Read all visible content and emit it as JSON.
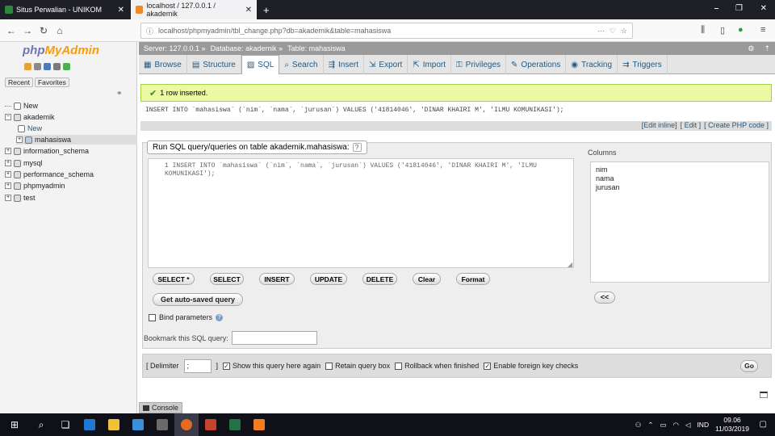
{
  "browser": {
    "tabs": [
      {
        "title": "Situs Perwalian - UNIKOM",
        "color": "#2c8a3e"
      },
      {
        "title": "localhost / 127.0.0.1 / akademik",
        "color": "#f08a24"
      }
    ],
    "url": "localhost/phpmyadmin/tbl_change.php?db=akademik&table=mahasiswa"
  },
  "sidebar": {
    "logo_main": "php",
    "logo_accent": "MyAdmin",
    "subtabs": [
      "Recent",
      "Favorites"
    ],
    "tree": [
      {
        "label": "New",
        "level": 0,
        "toggle": ""
      },
      {
        "label": "akademik",
        "level": 0,
        "toggle": "−"
      },
      {
        "label": "New",
        "level": 1,
        "toggle": ""
      },
      {
        "label": "mahasiswa",
        "level": 1,
        "toggle": "+"
      },
      {
        "label": "information_schema",
        "level": 0,
        "toggle": "+"
      },
      {
        "label": "mysql",
        "level": 0,
        "toggle": "+"
      },
      {
        "label": "performance_schema",
        "level": 0,
        "toggle": "+"
      },
      {
        "label": "phpmyadmin",
        "level": 0,
        "toggle": "+"
      },
      {
        "label": "test",
        "level": 0,
        "toggle": "+"
      }
    ]
  },
  "breadcrumb": {
    "server": "Server: 127.0.0.1 »",
    "database": "Database: akademik »",
    "table": "Table: mahasiswa"
  },
  "tabs": [
    "Browse",
    "Structure",
    "SQL",
    "Search",
    "Insert",
    "Export",
    "Import",
    "Privileges",
    "Operations",
    "Tracking",
    "Triggers"
  ],
  "active_tab": "SQL",
  "success_message": "1 row inserted.",
  "executed_sql": "INSERT INTO `mahasiswa` (`nim`, `nama`, `jurusan`) VALUES ('41814046', 'DINAR KHAIRI M', 'ILMU KOMUNIKASI');",
  "sql_links": [
    "[Edit inline]",
    "[ Edit ]",
    "[ Create PHP code ]"
  ],
  "query_legend": "Run SQL query/queries on table akademik.mahasiswa:",
  "editor_text": "1 INSERT INTO `mahasiswa` (`nim`, `nama`, `jurusan`) VALUES ('41814046', 'DINAR KHAIRI M', 'ILMU\nKOMUNIKASI');",
  "columns_label": "Columns",
  "columns": [
    "nim",
    "nama",
    "jurusan"
  ],
  "query_buttons": [
    "SELECT *",
    "SELECT",
    "INSERT",
    "UPDATE",
    "DELETE",
    "Clear",
    "Format"
  ],
  "autosave_label": "Get auto-saved query",
  "insert_col_button": "<<",
  "bind_label": "Bind parameters",
  "bookmark_label": "Bookmark this SQL query:",
  "delimiter_label": "[ Delimiter",
  "delimiter_value": ";",
  "delimiter_close": "]",
  "options": [
    {
      "label": "Show this query here again",
      "checked": true
    },
    {
      "label": "Retain query box",
      "checked": false
    },
    {
      "label": "Rollback when finished",
      "checked": false
    },
    {
      "label": "Enable foreign key checks",
      "checked": true
    }
  ],
  "go_label": "Go",
  "console_label": "Console",
  "taskbar": {
    "lang": "IND",
    "time": "09.06",
    "date": "11/03/2019"
  }
}
